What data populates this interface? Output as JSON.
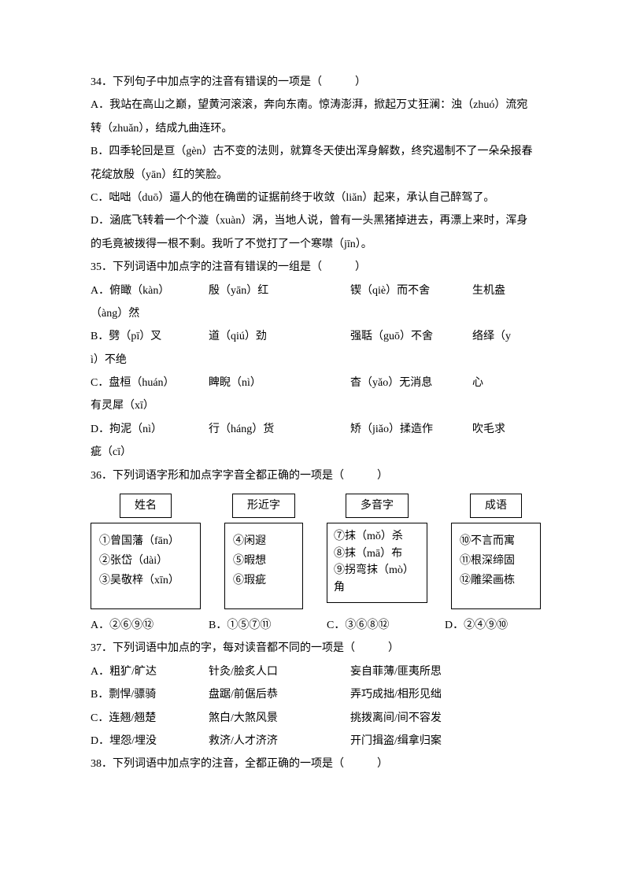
{
  "q34": {
    "stem": "34．下列句子中加点字的注音有错误的一项是（　　　）",
    "a": "A．我站在高山之巅，望黄河滚滚，奔向东南。惊涛澎湃，掀起万丈狂澜：浊（zhuó）流宛转（zhuǎn），结成九曲连环。",
    "b": "B．四季轮回是亘（gèn）古不变的法则，就算冬天使出浑身解数，终究遏制不了一朵朵报春花绽放殷（yān）红的笑脸。",
    "c": "C．咄咄（duō）逼人的他在确凿的证据前终于收敛（liǎn）起来，承认自己醉驾了。",
    "d": "D．涵底飞转着一个个漩（xuàn）涡，当地人说，曾有一头黑猪掉进去，再漂上来时，浑身的毛竟被拨得一根不剩。我听了不觉打了一个寒噤（jīn）。"
  },
  "q35": {
    "stem": "35．下列词语中加点字的注音有错误的一组是（　　　）",
    "a": [
      "A．俯瞰（kàn）",
      "殷（yān）红",
      "锲（qiè）而不舍",
      "生机盎"
    ],
    "a2": "（àng）然",
    "b": [
      "B．劈（pī）叉",
      "道（qiú）劲",
      "强聒（guō）不舍",
      "络绎（y"
    ],
    "b2": "ì）不绝",
    "c": [
      "C．盘桓（huán）",
      "睥睨（nì）",
      "杳（yǎo）无消息",
      "心"
    ],
    "c2": "有灵犀（xī）",
    "d": [
      "D．拘泥（nì）",
      "行（háng）货",
      "矫（jiǎo）揉造作",
      "吹毛求"
    ],
    "d2": "疵（cī）"
  },
  "q36": {
    "stem": "36．下列词语字形和加点字字音全都正确的一项是（　　　）",
    "headers": [
      "姓名",
      "形近字",
      "多音字",
      "成语"
    ],
    "col1": [
      "①曾国藩（fān）",
      "②张岱（dài）",
      "③吴敬梓（xīn）"
    ],
    "col2": [
      "④闲遐",
      "⑤暇想",
      "⑥瑕疵"
    ],
    "col3": [
      "⑦抹（mǒ）杀",
      "⑧抹（mā）布",
      "⑨拐弯抹（mò）",
      "角"
    ],
    "col4": [
      "⑩不言而寓",
      "⑪根深缔固",
      "⑫雕梁画栋"
    ],
    "opts": [
      "A．②⑥⑨⑫",
      "B．①⑤⑦⑪",
      "C．③⑥⑧⑫",
      "D．②④⑨⑩"
    ]
  },
  "q37": {
    "stem": "37．下列词语中加点的字，每对读音都不同的一项是（　　　）",
    "rows": [
      [
        "A．粗犷/旷达",
        "针灸/脍炙人口",
        "妄自菲薄/匪夷所思"
      ],
      [
        "B．剽悍/骠骑",
        "盘踞/前倨后恭",
        "弄巧成拙/相形见绌"
      ],
      [
        "C．连翘/翘楚",
        "煞白/大煞风景",
        "挑拨离间/间不容发"
      ],
      [
        "D．埋怨/埋没",
        "救济/人才济济",
        "开门揖盗/缉拿归案"
      ]
    ]
  },
  "q38": {
    "stem": "38．下列词语中加点字的注音，全都正确的一项是（　　　）"
  }
}
